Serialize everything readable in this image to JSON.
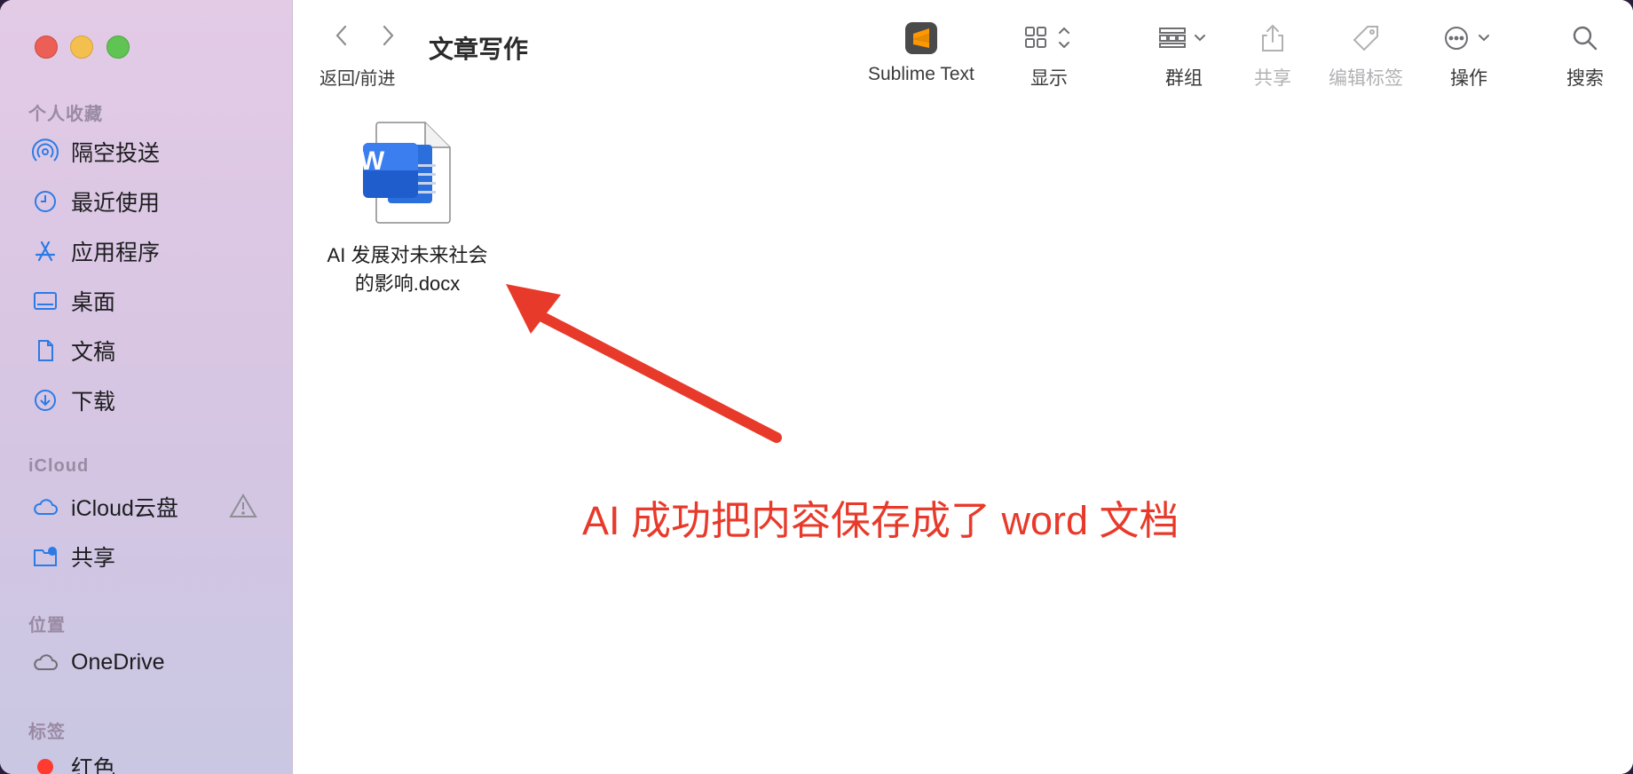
{
  "sidebar": {
    "favorites_title": "个人收藏",
    "favorites": [
      {
        "label": "隔空投送",
        "icon": "airdrop-icon"
      },
      {
        "label": "最近使用",
        "icon": "clock-icon"
      },
      {
        "label": "应用程序",
        "icon": "applications-icon"
      },
      {
        "label": "桌面",
        "icon": "desktop-icon"
      },
      {
        "label": "文稿",
        "icon": "document-icon"
      },
      {
        "label": "下载",
        "icon": "download-icon"
      }
    ],
    "icloud_title": "iCloud",
    "icloud": [
      {
        "label": "iCloud云盘",
        "icon": "cloud-icon"
      },
      {
        "label": "共享",
        "icon": "shared-folder-icon"
      }
    ],
    "locations_title": "位置",
    "locations": [
      {
        "label": "OneDrive",
        "icon": "cloud-drive-icon"
      }
    ],
    "tags_title": "标签",
    "tags": [
      {
        "label": "红色",
        "color": "#ff3b30"
      }
    ]
  },
  "toolbar": {
    "nav_label": "返回/前进",
    "folder_title": "文章写作",
    "sublime": "Sublime Text",
    "view": "显示",
    "group": "群组",
    "share": "共享",
    "tags": "编辑标签",
    "action": "操作",
    "search": "搜索"
  },
  "files": [
    {
      "name_line1": "AI 发展对未来社会",
      "name_line2": "的影响.docx",
      "badge": "W"
    }
  ],
  "annotation": "AI 成功把内容保存成了 word 文档",
  "colors": {
    "accent": "#2c7be5",
    "annotation": "#e83a2a"
  }
}
